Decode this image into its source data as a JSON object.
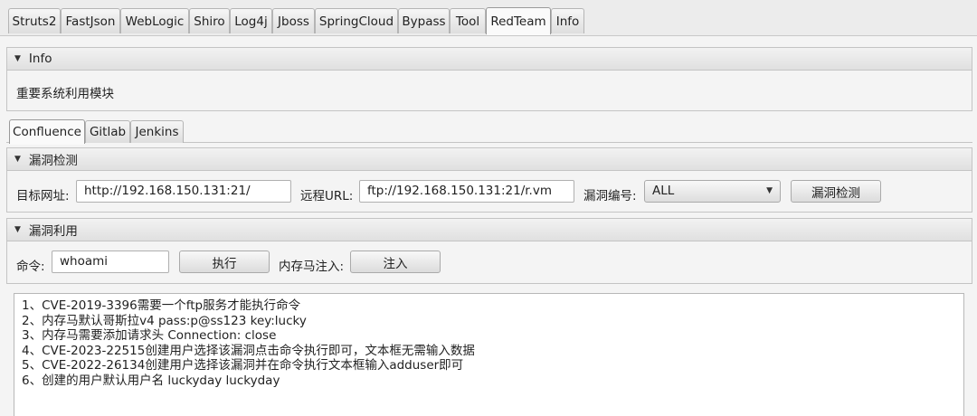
{
  "top_tabs": [
    "Struts2",
    "FastJson",
    "WebLogic",
    "Shiro",
    "Log4j",
    "Jboss",
    "SpringCloud",
    "Bypass",
    "Tool",
    "RedTeam",
    "Info"
  ],
  "info_pane": {
    "title": "Info",
    "text": "重要系统利用模块"
  },
  "sub_tabs": [
    "Confluence",
    "Gitlab",
    "Jenkins"
  ],
  "detect_pane": {
    "title": "漏洞检测",
    "target_label": "目标网址:",
    "target_value": "http://192.168.150.131:21/",
    "remote_label": "远程URL:",
    "remote_value": "ftp://192.168.150.131:21/r.vm",
    "cve_label": "漏洞编号:",
    "cve_selected": "ALL",
    "detect_button": "漏洞检测"
  },
  "exploit_pane": {
    "title": "漏洞利用",
    "cmd_label": "命令:",
    "cmd_value": "whoami",
    "exec_button": "执行",
    "inject_label": "内存马注入:",
    "inject_button": "注入"
  },
  "output_lines": [
    "1、CVE-2019-3396需要一个ftp服务才能执行命令",
    "2、内存马默认哥斯拉v4 pass:p@ss123 key:lucky",
    "3、内存马需要添加请求头 Connection: close",
    "4、CVE-2023-22515创建用户选择该漏洞点击命令执行即可，文本框无需输入数据",
    "5、CVE-2022-26134创建用户选择该漏洞并在命令执行文本框输入adduser即可",
    "6、创建的用户默认用户名 luckyday luckyday"
  ]
}
